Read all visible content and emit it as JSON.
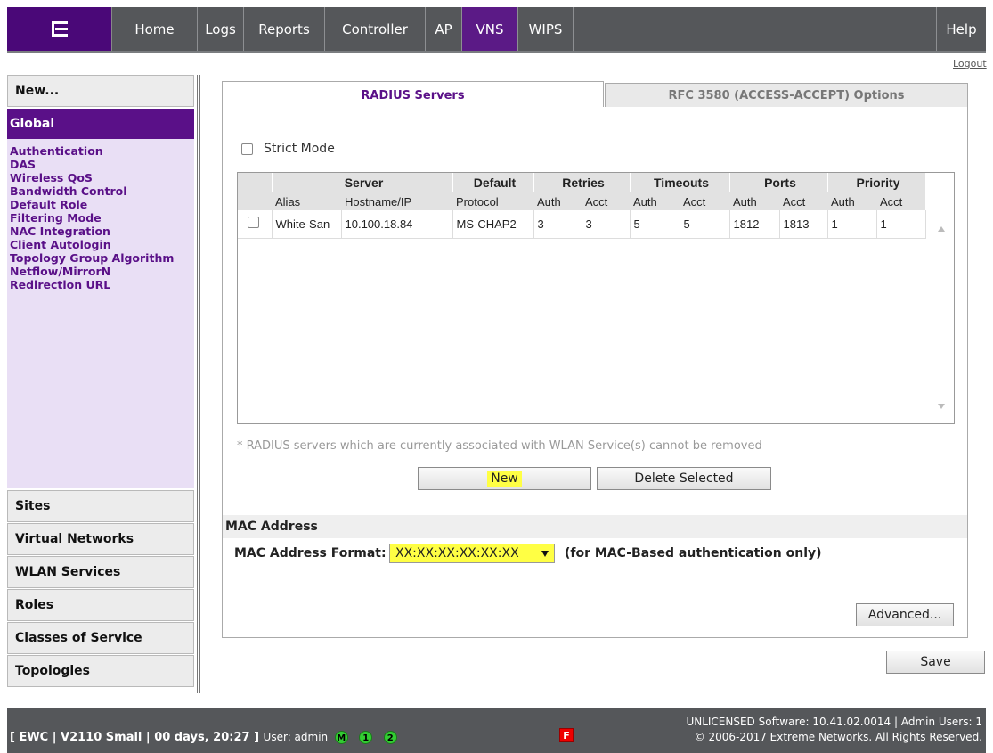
{
  "nav": {
    "logo_icon": "extreme-networks-logo",
    "tabs": [
      {
        "label": "Home"
      },
      {
        "label": "Logs"
      },
      {
        "label": "Reports"
      },
      {
        "label": "Controller"
      },
      {
        "label": "AP"
      },
      {
        "label": "VNS",
        "active": true
      },
      {
        "label": "WIPS"
      }
    ],
    "help_label": "Help",
    "logout_label": "Logout"
  },
  "sidebar": {
    "new_label": "New...",
    "global_label": "Global",
    "global_items": [
      "Authentication",
      "DAS",
      "Wireless QoS",
      "Bandwidth Control",
      "Default Role",
      "Filtering Mode",
      "NAC Integration",
      "Client Autologin",
      "Topology Group Algorithm",
      "Netflow/MirrorN",
      "Redirection URL"
    ],
    "sections": [
      "Sites",
      "Virtual Networks",
      "WLAN Services",
      "Roles",
      "Classes of Service",
      "Topologies"
    ]
  },
  "tabs": {
    "active": "RADIUS Servers",
    "inactive": "RFC 3580 (ACCESS-ACCEPT) Options"
  },
  "strict_mode_label": "Strict Mode",
  "table": {
    "group_headers": [
      "Server",
      "Default",
      "Retries",
      "Timeouts",
      "Ports",
      "Priority"
    ],
    "sub_headers": [
      "Alias",
      "Hostname/IP",
      "Protocol",
      "Auth",
      "Acct",
      "Auth",
      "Acct",
      "Auth",
      "Acct",
      "Auth",
      "Acct"
    ],
    "rows": [
      {
        "cells": [
          "White-San",
          "10.100.18.84",
          "MS-CHAP2",
          "3",
          "3",
          "5",
          "5",
          "1812",
          "1813",
          "1",
          "1"
        ]
      }
    ]
  },
  "note": "* RADIUS servers which are currently associated with WLAN Service(s) cannot be removed",
  "buttons": {
    "new": "New",
    "delete": "Delete Selected",
    "advanced": "Advanced...",
    "save": "Save"
  },
  "mac": {
    "section_title": "MAC Address",
    "label": "MAC Address Format:",
    "value": "XX:XX:XX:XX:XX:XX",
    "note": "(for MAC-Based authentication only)"
  },
  "status": {
    "left": "[ EWC | V2110 Small | 00 days, 20:27 ]",
    "user": "User: admin",
    "badges": [
      "M",
      "1",
      "2"
    ],
    "flag": "F",
    "right_line1": "UNLICENSED Software: 10.41.02.0014 | Admin Users: 1",
    "right_line2": "© 2006-2017  Extreme Networks. All Rights Reserved."
  },
  "colors": {
    "brand_purple": "#5a1088",
    "nav_gray": "#55575a",
    "highlight": "#ffff44",
    "badge_green": "#33cc33",
    "flag_red": "#ee0000"
  }
}
